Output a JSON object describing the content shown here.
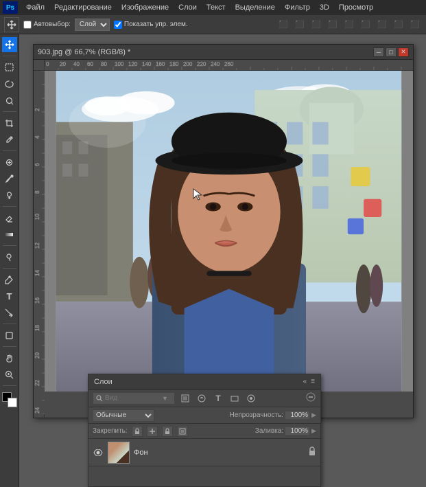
{
  "app": {
    "logo": "Ps",
    "title": "Adobe Photoshop"
  },
  "menu": {
    "items": [
      "Файл",
      "Редактирование",
      "Изображение",
      "Слои",
      "Текст",
      "Выделение",
      "Фильтр",
      "3D",
      "Просмотр"
    ]
  },
  "options_bar": {
    "move_tool_label": "Автовыбор:",
    "layer_select": "Слой",
    "show_controls_label": "Показать упр. элем.",
    "show_controls_checked": true
  },
  "document": {
    "title": "903.jpg @ 66,7% (RGB/8) *",
    "zoom": "66,7%",
    "mode": "RGB/8"
  },
  "layers_panel": {
    "title": "Слои",
    "search_placeholder": "Вид",
    "blend_mode": "Обычные",
    "opacity_label": "Непрозрачность:",
    "opacity_value": "100%",
    "lock_label": "Закрепить:",
    "fill_label": "Заливка:",
    "fill_value": "100%",
    "layers": [
      {
        "name": "Фон",
        "visible": true,
        "locked": true,
        "selected": false
      }
    ],
    "bottom_icons": [
      "new-layer",
      "adjustment-layer",
      "layer-mask",
      "layer-style",
      "delete-layer"
    ]
  },
  "tools": {
    "active": "move",
    "items": [
      {
        "name": "move",
        "icon": "✛"
      },
      {
        "name": "select-rect",
        "icon": "▭"
      },
      {
        "name": "lasso",
        "icon": "⌖"
      },
      {
        "name": "quick-select",
        "icon": "⊙"
      },
      {
        "name": "crop",
        "icon": "⊡"
      },
      {
        "name": "eyedropper",
        "icon": "✏"
      },
      {
        "name": "heal",
        "icon": "⊕"
      },
      {
        "name": "brush",
        "icon": "✒"
      },
      {
        "name": "clone",
        "icon": "⊗"
      },
      {
        "name": "eraser",
        "icon": "◻"
      },
      {
        "name": "gradient",
        "icon": "◱"
      },
      {
        "name": "dodge",
        "icon": "◖"
      },
      {
        "name": "pen",
        "icon": "✐"
      },
      {
        "name": "text",
        "icon": "T"
      },
      {
        "name": "path-select",
        "icon": "↖"
      },
      {
        "name": "shape",
        "icon": "▭"
      },
      {
        "name": "hand",
        "icon": "☜"
      },
      {
        "name": "zoom",
        "icon": "⊕"
      }
    ]
  }
}
